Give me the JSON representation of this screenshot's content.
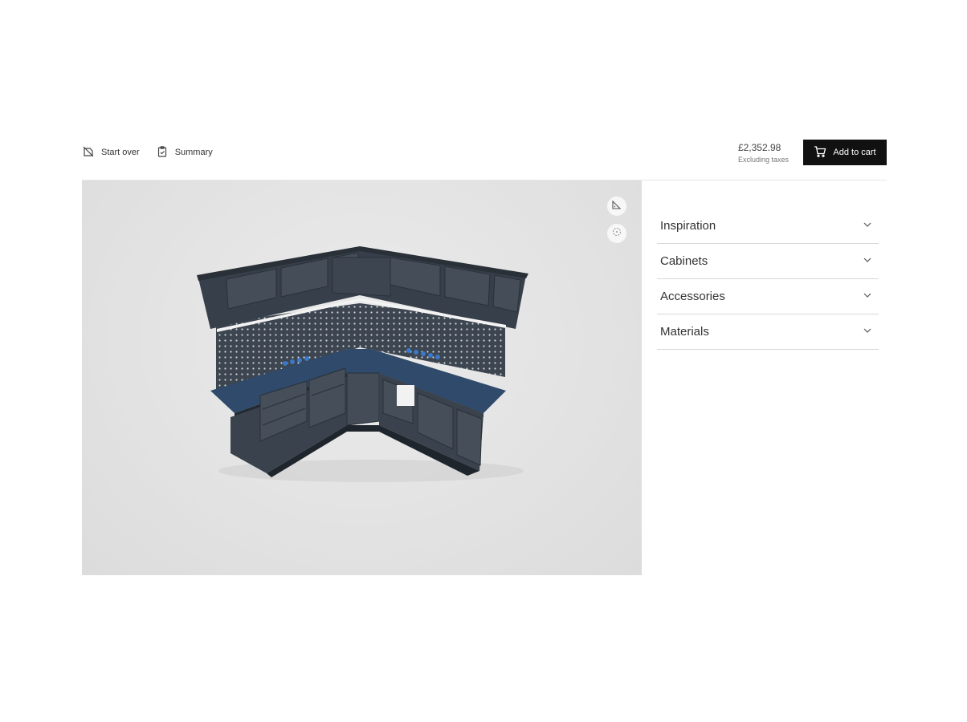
{
  "toolbar": {
    "start_over_label": "Start over",
    "summary_label": "Summary",
    "price": "£2,352.98",
    "price_note": "Excluding taxes",
    "add_to_cart_label": "Add to cart"
  },
  "viewer": {
    "tools": [
      "measure-icon",
      "recenter-icon"
    ],
    "product": {
      "cabinet_color": "#3b434d",
      "accent_color": "#3a78c9"
    }
  },
  "panel": {
    "sections": [
      {
        "label": "Inspiration"
      },
      {
        "label": "Cabinets"
      },
      {
        "label": "Accessories"
      },
      {
        "label": "Materials"
      }
    ]
  }
}
